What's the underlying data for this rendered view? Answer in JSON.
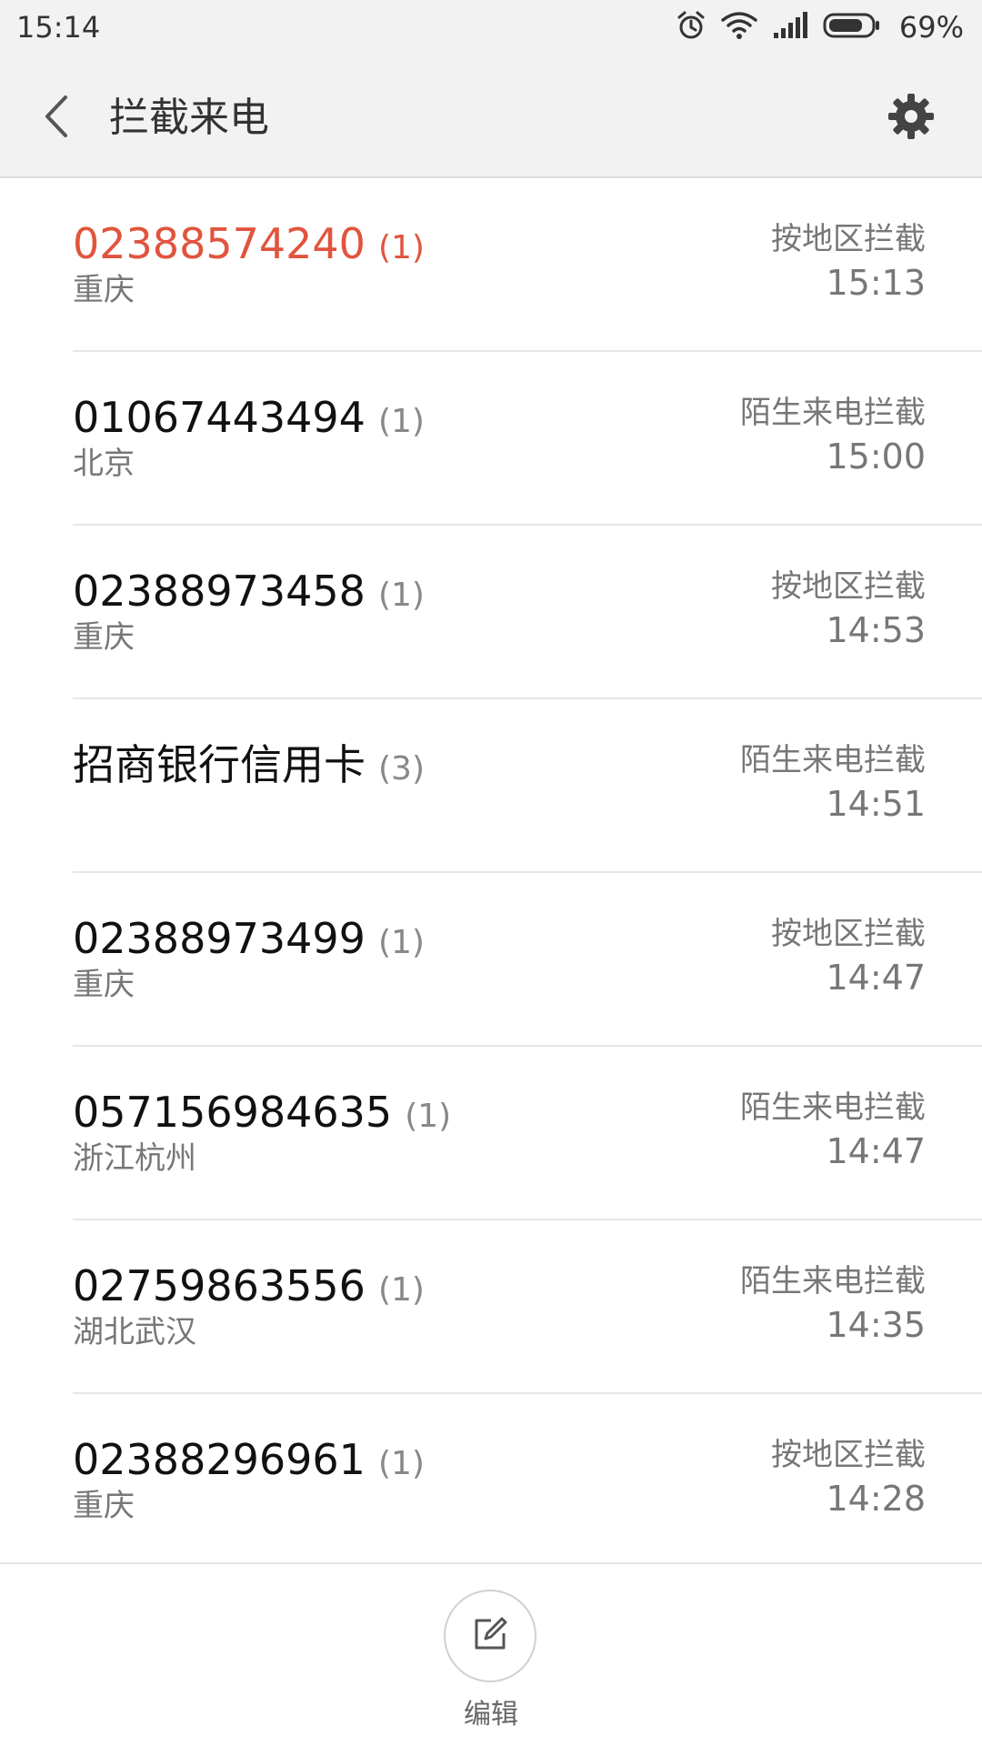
{
  "status_bar": {
    "time": "15:14",
    "battery": "69%"
  },
  "header": {
    "title": "拦截来电"
  },
  "calls": [
    {
      "number": "02388574240",
      "count": "(1)",
      "location": "重庆",
      "reason": "按地区拦截",
      "time": "15:13",
      "missed": true
    },
    {
      "number": "01067443494",
      "count": "(1)",
      "location": "北京",
      "reason": "陌生来电拦截",
      "time": "15:00",
      "missed": false
    },
    {
      "number": "02388973458",
      "count": "(1)",
      "location": "重庆",
      "reason": "按地区拦截",
      "time": "14:53",
      "missed": false
    },
    {
      "number": "招商银行信用卡",
      "count": "(3)",
      "location": "",
      "reason": "陌生来电拦截",
      "time": "14:51",
      "missed": false
    },
    {
      "number": "02388973499",
      "count": "(1)",
      "location": "重庆",
      "reason": "按地区拦截",
      "time": "14:47",
      "missed": false
    },
    {
      "number": "057156984635",
      "count": "(1)",
      "location": "浙江杭州",
      "reason": "陌生来电拦截",
      "time": "14:47",
      "missed": false
    },
    {
      "number": "02759863556",
      "count": "(1)",
      "location": "湖北武汉",
      "reason": "陌生来电拦截",
      "time": "14:35",
      "missed": false
    },
    {
      "number": "02388296961",
      "count": "(1)",
      "location": "重庆",
      "reason": "按地区拦截",
      "time": "14:28",
      "missed": false
    }
  ],
  "bottom": {
    "edit_label": "编辑"
  },
  "colors": {
    "accent": "#e1543d",
    "header_bg": "#f2f2f2"
  },
  "icons": {
    "back": "chevron-left-icon",
    "settings": "gear-icon",
    "edit": "edit-icon",
    "alarm": "alarm-icon",
    "wifi": "wifi-icon",
    "signal": "signal-icon",
    "battery": "battery-icon"
  }
}
